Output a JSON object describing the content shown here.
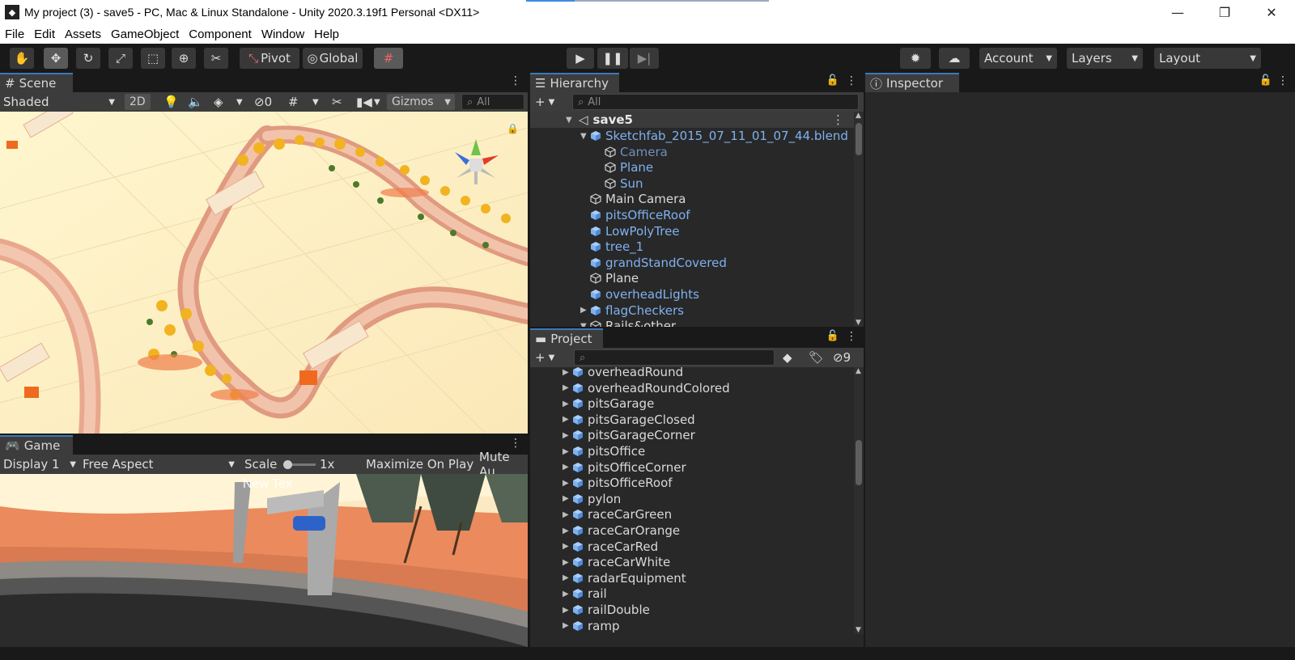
{
  "window": {
    "title": "My project (3) - save5 - PC, Mac & Linux Standalone - Unity 2020.3.19f1 Personal <DX11>",
    "minimize": "—",
    "restore": "❐",
    "close": "✕"
  },
  "menu": [
    "File",
    "Edit",
    "Assets",
    "GameObject",
    "Component",
    "Window",
    "Help"
  ],
  "toolbar": {
    "pivot_label": "Pivot",
    "global_label": "Global",
    "account_label": "Account",
    "layers_label": "Layers",
    "layout_label": "Layout"
  },
  "scene": {
    "tab": "Scene",
    "shading": "Shaded",
    "mode_2d": "2D",
    "hidden_count": "0",
    "gizmos": "Gizmos",
    "search_placeholder": "All"
  },
  "game": {
    "tab": "Game",
    "display": "Display 1",
    "aspect": "Free Aspect",
    "scale_label": "Scale",
    "scale_value": "1x",
    "maximize": "Maximize On Play",
    "mute": "Mute Au",
    "overlay_text": "New Tex"
  },
  "hierarchy": {
    "tab": "Hierarchy",
    "search_placeholder": "All",
    "scene_name": "save5",
    "items": [
      {
        "label": "Sketchfab_2015_07_11_01_07_44.blend",
        "indent": 1,
        "arrow": "▼",
        "color": "blue",
        "icon": "prefab-cube-icon"
      },
      {
        "label": "Camera",
        "indent": 2,
        "arrow": "",
        "color": "dim",
        "icon": "gameobject-cube-icon"
      },
      {
        "label": "Plane",
        "indent": 2,
        "arrow": "",
        "color": "blue",
        "icon": "gameobject-cube-icon"
      },
      {
        "label": "Sun",
        "indent": 2,
        "arrow": "",
        "color": "blue",
        "icon": "gameobject-cube-icon"
      },
      {
        "label": "Main Camera",
        "indent": 1,
        "arrow": "",
        "color": "white",
        "icon": "gameobject-cube-icon"
      },
      {
        "label": "pitsOfficeRoof",
        "indent": 1,
        "arrow": "",
        "color": "blue",
        "icon": "prefab-cube-icon"
      },
      {
        "label": "LowPolyTree",
        "indent": 1,
        "arrow": "",
        "color": "blue",
        "icon": "prefab-cube-icon"
      },
      {
        "label": "tree_1",
        "indent": 1,
        "arrow": "",
        "color": "blue",
        "icon": "prefab-cube-icon"
      },
      {
        "label": "grandStandCovered",
        "indent": 1,
        "arrow": "",
        "color": "blue",
        "icon": "prefab-cube-icon"
      },
      {
        "label": "Plane",
        "indent": 1,
        "arrow": "",
        "color": "white",
        "icon": "gameobject-cube-icon"
      },
      {
        "label": "overheadLights",
        "indent": 1,
        "arrow": "",
        "color": "blue",
        "icon": "prefab-cube-icon"
      },
      {
        "label": "flagCheckers",
        "indent": 1,
        "arrow": "▶",
        "color": "blue",
        "icon": "prefab-cube-icon"
      },
      {
        "label": "Rails&other",
        "indent": 1,
        "arrow": "▼",
        "color": "white",
        "icon": "gameobject-cube-icon"
      }
    ]
  },
  "project": {
    "tab": "Project",
    "hidden_count": "9",
    "items": [
      "overheadRound",
      "overheadRoundColored",
      "pitsGarage",
      "pitsGarageClosed",
      "pitsGarageCorner",
      "pitsOffice",
      "pitsOfficeCorner",
      "pitsOfficeRoof",
      "pylon",
      "raceCarGreen",
      "raceCarOrange",
      "raceCarRed",
      "raceCarWhite",
      "radarEquipment",
      "rail",
      "railDouble",
      "ramp"
    ]
  },
  "inspector": {
    "tab": "Inspector"
  }
}
